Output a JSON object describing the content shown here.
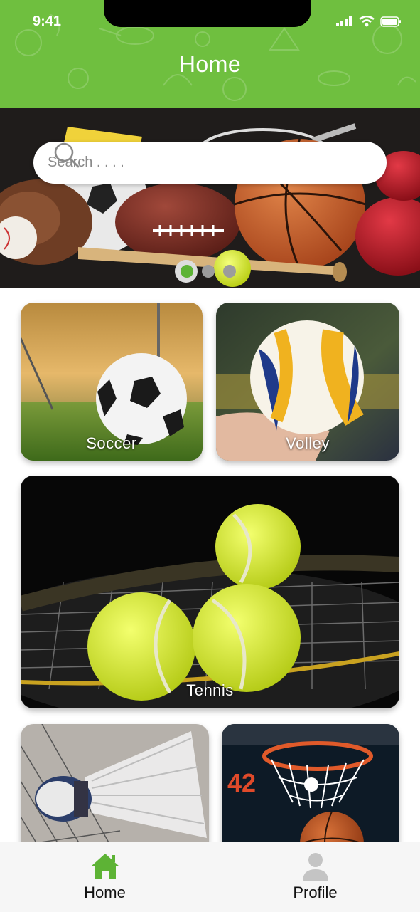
{
  "status_bar": {
    "time": "9:41"
  },
  "header": {
    "title": "Home"
  },
  "search": {
    "placeholder": "Search . . . ."
  },
  "carousel": {
    "total": 3,
    "active_index": 0
  },
  "categories": [
    {
      "label": "Soccer"
    },
    {
      "label": "Volley"
    },
    {
      "label": "Tennis"
    },
    {
      "label": ""
    },
    {
      "label": ""
    }
  ],
  "bottom_nav": {
    "items": [
      {
        "label": "Home",
        "icon": "home-icon",
        "active": true
      },
      {
        "label": "Profile",
        "icon": "user-icon",
        "active": false
      }
    ]
  },
  "colors": {
    "brand_green": "#6fbf3f",
    "active_icon": "#5db335",
    "inactive_icon": "#c4c4c4"
  }
}
